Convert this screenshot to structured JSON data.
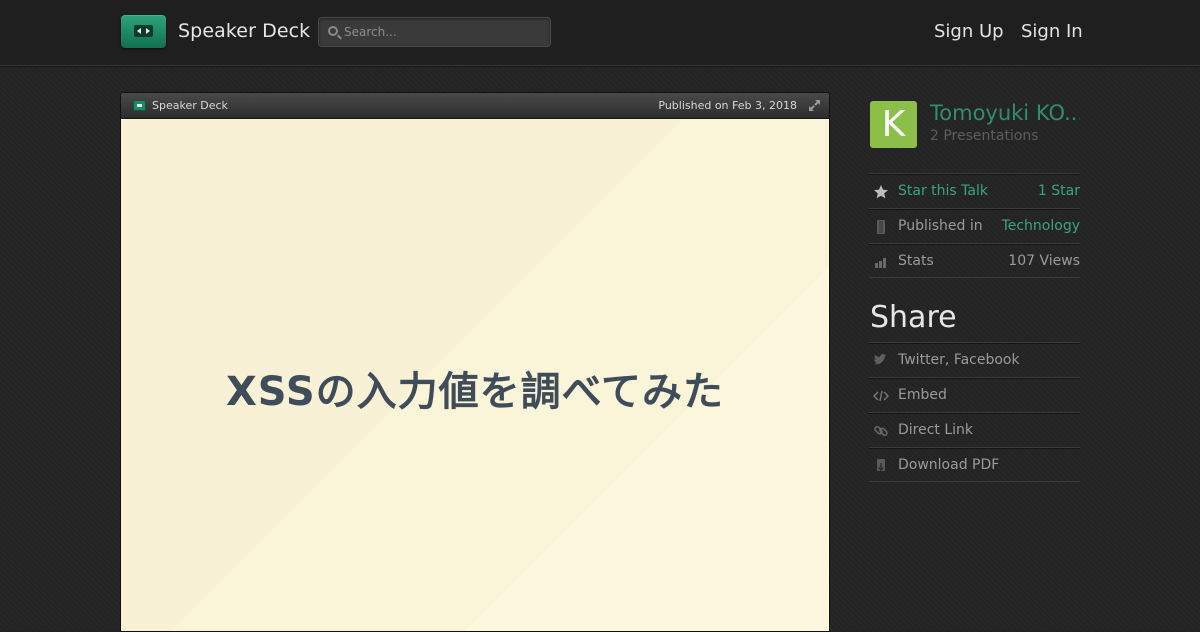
{
  "header": {
    "brand": "Speaker Deck",
    "search_placeholder": "Search...",
    "sign_up": "Sign Up",
    "sign_in": "Sign In"
  },
  "player": {
    "brand": "Speaker Deck",
    "published": "Published on Feb 3, 2018",
    "slide_title": "XSSの入力値を調べてみた"
  },
  "author": {
    "initial": "K",
    "name": "Tomoyuki KO...",
    "presentations": "2 Presentations",
    "avatar_color": "#8bbf4a"
  },
  "meta": [
    {
      "icon": "star-icon",
      "label": "Star this Talk",
      "value": "1 Star"
    },
    {
      "icon": "bookmark-icon",
      "label": "Published in",
      "value": "Technology"
    },
    {
      "icon": "bar-chart-icon",
      "label": "Stats",
      "value": "107 Views"
    }
  ],
  "share": {
    "title": "Share",
    "items": [
      {
        "icon": "bird-icon",
        "label": "Twitter, Facebook"
      },
      {
        "icon": "code-icon",
        "label": "Embed"
      },
      {
        "icon": "link-icon",
        "label": "Direct Link"
      },
      {
        "icon": "download-icon",
        "label": "Download PDF"
      }
    ]
  },
  "colors": {
    "accent": "#2f8f6a",
    "background": "#242424",
    "slide_bg": "#fbf6dc",
    "slide_text": "#3f4d5a"
  }
}
